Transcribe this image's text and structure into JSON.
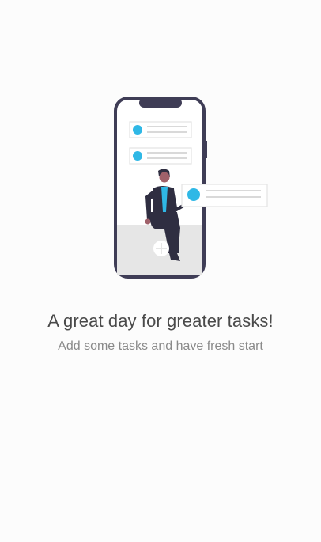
{
  "empty_state": {
    "title": "A great day for greater tasks!",
    "subtitle": "Add some tasks and have fresh start",
    "illustration_icon": "person-with-phone-task-list-illustration"
  },
  "colors": {
    "background": "#fcfcfc",
    "accent": "#2fb8e6",
    "phone_frame": "#3f3d56",
    "title_text": "#4a4a4a",
    "subtitle_text": "#8a8a8a"
  }
}
